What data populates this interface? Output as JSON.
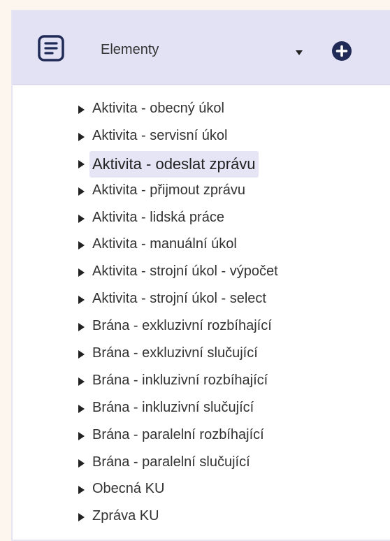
{
  "header": {
    "title": "Elementy",
    "icon": "document-list-icon",
    "add_icon": "plus-circle-icon",
    "accent_color": "#1f2a56"
  },
  "elements": [
    {
      "label": "Aktivita - obecný úkol"
    },
    {
      "label": "Aktivita - servisní úkol"
    },
    {
      "label": "Aktivita - odeslat zprávu",
      "highlighted": true
    },
    {
      "label": "Aktivita - přijmout zprávu"
    },
    {
      "label": "Aktivita - lidská práce"
    },
    {
      "label": "Aktivita - manuální úkol"
    },
    {
      "label": "Aktivita - strojní úkol - výpočet"
    },
    {
      "label": "Aktivita - strojní úkol - select"
    },
    {
      "label": "Brána - exkluzivní rozbíhající"
    },
    {
      "label": "Brána - exkluzivní slučující"
    },
    {
      "label": "Brána - inkluzivní rozbíhající"
    },
    {
      "label": "Brána - inkluzivní slučující"
    },
    {
      "label": "Brána - paralelní rozbíhající"
    },
    {
      "label": "Brána - paralelní slučující"
    },
    {
      "label": "Obecná KU"
    },
    {
      "label": "Zpráva KU"
    }
  ]
}
